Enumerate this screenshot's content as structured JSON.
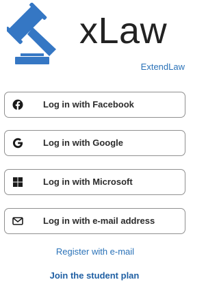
{
  "header": {
    "app_title": "xLaw",
    "subtitle_link": "ExtendLaw",
    "logo_icon": "gavel-icon",
    "brand_color": "#3577c4"
  },
  "login_options": [
    {
      "label": "Log in with Facebook",
      "icon": "facebook-icon"
    },
    {
      "label": "Log in with Google",
      "icon": "google-icon"
    },
    {
      "label": "Log in with Microsoft",
      "icon": "microsoft-icon"
    },
    {
      "label": "Log in with e-mail address",
      "icon": "mail-icon"
    }
  ],
  "footer": {
    "register_link": "Register with e-mail",
    "student_link": "Join the student plan",
    "link_color": "#2a72b8"
  }
}
